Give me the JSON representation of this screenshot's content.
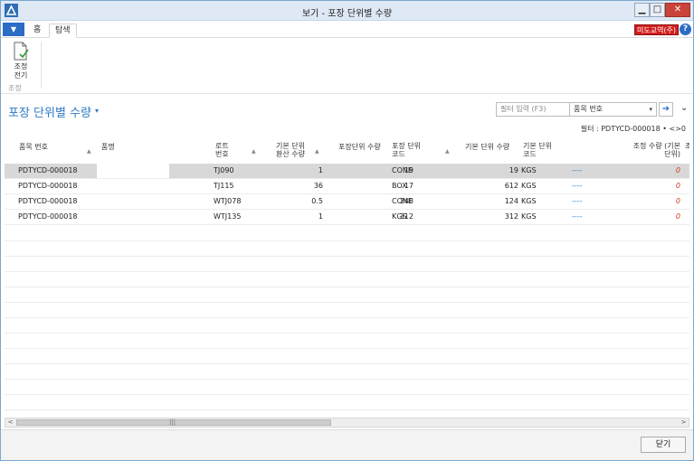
{
  "window": {
    "title": "보기 - 포장 단위별 수량",
    "minimize_glyph": "▁",
    "maximize_glyph": "□",
    "close_glyph": "✕"
  },
  "ribbon": {
    "file_tab_glyph": "▼",
    "tabs": [
      {
        "label": "홈"
      },
      {
        "label": "탐색"
      }
    ],
    "company_badge": "미도교역(주)",
    "help_glyph": "?",
    "adjust_button_label_1": "조정",
    "adjust_button_label_2": "전기",
    "group_label": "조정"
  },
  "page": {
    "title": "포장 단위별 수량",
    "title_caret": "▾",
    "filter_placeholder": "필터 입력 (F3)",
    "filter_field": "품목 번호",
    "filter_field_caret": "▾",
    "filter_go_glyph": "➔",
    "collapse_glyph": "⌄",
    "filter_summary": "필터 : PDTYCD-000018 • <>0"
  },
  "grid": {
    "headers": {
      "item_no": "품목 번호",
      "description": "품명",
      "lot_1": "로트",
      "lot_2": "번호",
      "conv_1": "기본 단위",
      "conv_2": "환산 수량",
      "pkg_qty": "포장단위 수량",
      "pkg_code_1": "포장 단위",
      "pkg_code_2": "코드",
      "base_qty": "기본 단위 수량",
      "base_code_1": "기본 단위",
      "base_code_2": "코드",
      "adj_qty_1": "조정 수량 (기본",
      "adj_qty_2": "단위)",
      "overflow": "조"
    },
    "rows": [
      {
        "item_no": "PDTYCD-000018",
        "description": "",
        "lot": "TJ090",
        "conv": "1",
        "pkg_qty": "19",
        "pkg_code": "CONE",
        "base_qty": "19",
        "base_code": "KGS",
        "dash": "----",
        "adj": "0"
      },
      {
        "item_no": "PDTYCD-000018",
        "description": "",
        "lot": "TJ115",
        "conv": "36",
        "pkg_qty": "17",
        "pkg_code": "BOX",
        "base_qty": "612",
        "base_code": "KGS",
        "dash": "----",
        "adj": "0"
      },
      {
        "item_no": "PDTYCD-000018",
        "description": "",
        "lot": "WTJ078",
        "conv": "0.5",
        "pkg_qty": "248",
        "pkg_code": "CONE",
        "base_qty": "124",
        "base_code": "KGS",
        "dash": "----",
        "adj": "0"
      },
      {
        "item_no": "PDTYCD-000018",
        "description": "",
        "lot": "WTJ135",
        "conv": "1",
        "pkg_qty": "312",
        "pkg_code": "KGS",
        "base_qty": "312",
        "base_code": "KGS",
        "dash": "----",
        "adj": "0"
      }
    ]
  },
  "scrollbar": {
    "left_glyph": "<",
    "right_glyph": ">",
    "grip_glyph": "|||"
  },
  "footer": {
    "close_label": "닫기"
  }
}
